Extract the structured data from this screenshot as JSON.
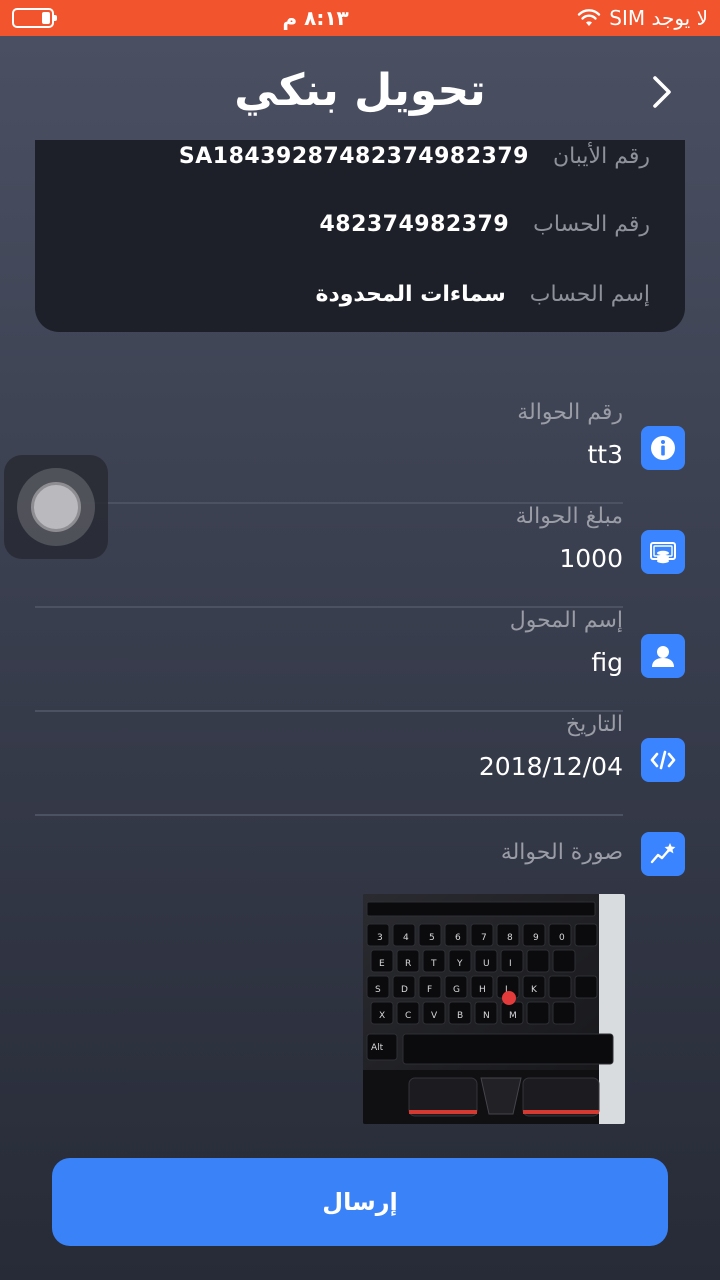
{
  "status_bar": {
    "carrier": "لا يوجد SIM",
    "time": "٨:١٣ م",
    "bar_color": "#f2542d"
  },
  "header": {
    "title": "تحويل بنكي",
    "back_icon": "chevron-right-icon"
  },
  "bank_account": {
    "iban_label": "رقم الأيبان",
    "iban_value": "SA18439287482374982379",
    "account_number_label": "رقم الحساب",
    "account_number_value": "482374982379",
    "account_name_label": "إسم الحساب",
    "account_name_value": "سماءات المحدودة"
  },
  "details": {
    "transfer_number_label": "رقم الحوالة",
    "transfer_number_value": "tt3",
    "transfer_number_icon": "info-icon",
    "amount_label": "مبلغ الحوالة",
    "amount_value": "1000",
    "amount_icon": "money-icon",
    "sender_name_label": "إسم المحول",
    "sender_name_value": "fig",
    "sender_icon": "user-icon",
    "date_label": "التاريخ",
    "date_value": "2018/12/04",
    "date_icon": "code-icon",
    "photo_label": "صورة الحوالة",
    "photo_icon": "image-star-icon"
  },
  "actions": {
    "submit_label": "إرسال",
    "accent_color": "#3a82f7"
  }
}
